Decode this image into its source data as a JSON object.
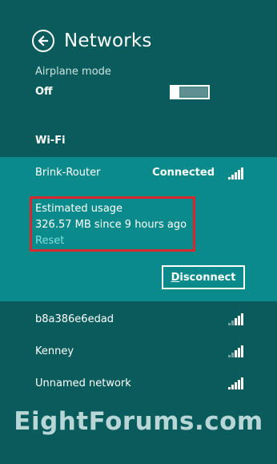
{
  "header": {
    "title": "Networks"
  },
  "airplane_mode": {
    "label": "Airplane mode",
    "value": "Off"
  },
  "sections": {
    "wifi": "Wi-Fi"
  },
  "connected_network": {
    "name": "Brink-Router",
    "status": "Connected",
    "usage_label": "Estimated usage",
    "usage_value": "326.57 MB since 9 hours ago",
    "reset_label": "Reset",
    "disconnect_label": "Disconnect",
    "signal_bars": 5
  },
  "networks": [
    {
      "name": "b8a386e6edad",
      "signal_bars": 3
    },
    {
      "name": "Kenney",
      "signal_bars": 3
    },
    {
      "name": "Unnamed network",
      "signal_bars": 5
    }
  ],
  "watermark": "EightForums.com",
  "colors": {
    "background": "#0a5b5c",
    "connected_panel": "#0a8a8b",
    "highlight_box": "#d9272e",
    "link": "#7fe0e0"
  }
}
